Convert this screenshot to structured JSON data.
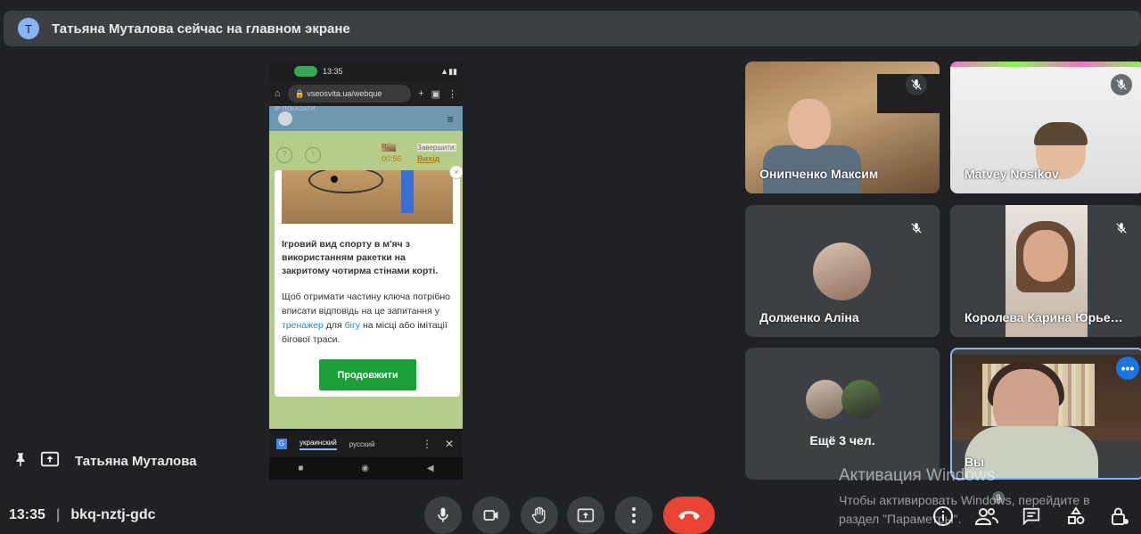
{
  "banner": {
    "avatar_letter": "Т",
    "text": "Татьяна Муталова сейчас на главном экране"
  },
  "phone": {
    "status_time": "13:35",
    "url": "vseosvita.ua/webque",
    "page_tiny": "ІР ПОКАЗАТИ",
    "time_label": "Час:",
    "time_value": "00:56",
    "finish_label": "Завершити:",
    "finish_value": "Вихід",
    "question": "Ігровий вид спорту в м'яч з використанням ракетки на закритому чотирма стінами корті.",
    "body_1": "Щоб отримати частину ключа потрібно вписати відповідь на це запитання у",
    "body_link_1": "тренажер",
    "body_2": " для ",
    "body_link_2": "бігу",
    "body_3": " на місці або імітації бігової траси.",
    "continue_btn": "Продовжити",
    "translate_lang_1": "украинский",
    "translate_lang_2": "русский"
  },
  "tiles": [
    {
      "name": "Онипченко Максим",
      "muted": true
    },
    {
      "name": "Matvey Nosikov",
      "muted": true
    },
    {
      "name": "Долженко Аліна",
      "muted": true
    },
    {
      "name": "Королева Карина Юрье…",
      "muted": true
    },
    {
      "name": "Ещё 3 чел."
    },
    {
      "name": "Вы"
    }
  ],
  "presenter": {
    "name": "Татьяна Муталова"
  },
  "bottom": {
    "time": "13:35",
    "separator": "|",
    "meeting_code": "bkq-nztj-gdc",
    "participants_badge": "9"
  },
  "watermark": {
    "line1": "Активация Windows",
    "line2": "Чтобы активировать Windows, перейдите в",
    "line3": "раздел \"Параметры\"."
  },
  "colors": {
    "end_call": "#ea4335",
    "accent": "#8ab4f8",
    "continue_btn": "#1aa036"
  }
}
